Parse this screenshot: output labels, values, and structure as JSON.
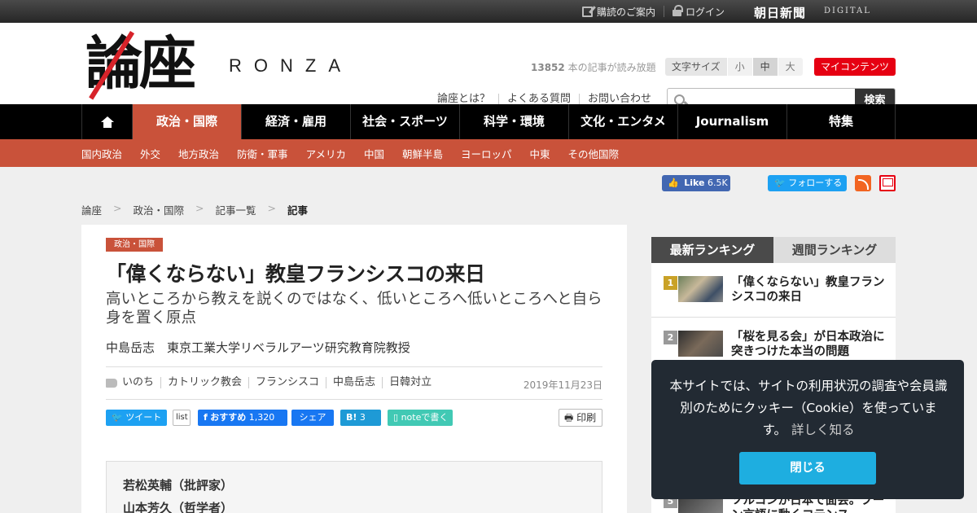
{
  "topbar": {
    "subscribe_label": "購読のご案内",
    "login_label": "ログイン",
    "brand": "朝日新聞",
    "brand_sub": "DIGITAL"
  },
  "header": {
    "logo_kanji": "論座",
    "logo_roman": "RONZA",
    "article_count": "13852",
    "article_count_suffix": " 本の記事が読み放題",
    "fontsize_label": "文字サイズ",
    "fontsize_options": [
      "小",
      "中",
      "大"
    ],
    "fontsize_selected": "中",
    "my_contents_label": "マイコンテンツ",
    "links": [
      "論座とは？",
      "よくある質問",
      "お問い合わせ"
    ],
    "search_placeholder": "",
    "search_button": "検索"
  },
  "nav": {
    "items": [
      "政治・国際",
      "経済・雇用",
      "社会・スポーツ",
      "科学・環境",
      "文化・エンタメ",
      "Journalism",
      "特集"
    ],
    "active": "政治・国際"
  },
  "subnav": {
    "items": [
      "国内政治",
      "外交",
      "地方政治",
      "防衛・軍事",
      "アメリカ",
      "中国",
      "朝鮮半島",
      "ヨーロッパ",
      "中東",
      "その他国際"
    ]
  },
  "social": {
    "fb_like_label": "Like",
    "fb_like_count": "6.5K",
    "twitter_follow_label": "フォローする"
  },
  "breadcrumb": {
    "items": [
      "論座",
      "政治・国際",
      "記事一覧",
      "記事"
    ],
    "separator": ">"
  },
  "article": {
    "category": "政治・国際",
    "title": "「偉くならない」教皇フランシスコの来日",
    "subtitle": "高いところから教えを説くのではなく、低いところへ低いところへと自ら身を置く原点",
    "author": "中島岳志　東京工業大学リベラルアーツ研究教育院教授",
    "tags": [
      "いのち",
      "カトリック教会",
      "フランシスコ",
      "中島岳志",
      "日韓対立"
    ],
    "date": "2019年11月23日",
    "share": {
      "tweet": "ツイート",
      "list": "list",
      "fb_recommend": "おすすめ",
      "fb_count": "1,320",
      "fb_share": "シェア",
      "hatena_count": "3",
      "note": "noteで書く",
      "print": "印刷"
    },
    "related_authors": [
      "若松英輔（批評家）",
      "山本芳久（哲学者）"
    ]
  },
  "ranking": {
    "tabs": [
      "最新ランキング",
      "週間ランキング"
    ],
    "active_tab": "最新ランキング",
    "items": [
      {
        "rank": "1",
        "title": "「偉くならない」教皇フランシスコの来日"
      },
      {
        "rank": "2",
        "title": "「桜を見る会」が日本政治に突きつけた本当の問題"
      },
      {
        "rank": "5",
        "title": "ソルコンが日本で面会。ブーン言語に動くコテンス"
      }
    ]
  },
  "cookie": {
    "text": "本サイトでは、サイトの利用状況の調査や会員識別のためにクッキー（Cookie）を使っています。",
    "more_link": "詳しく知る",
    "close_button": "閉じる"
  }
}
